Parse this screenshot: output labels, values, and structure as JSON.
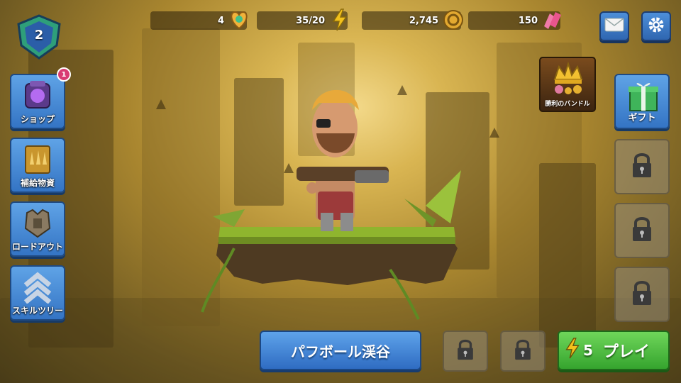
{
  "player": {
    "level": "2"
  },
  "resources": {
    "lives": "4",
    "energy": "35/20",
    "coins": "2,745",
    "gems": "150"
  },
  "top_buttons": {
    "mail_icon": "mail-icon",
    "settings_icon": "gear-icon"
  },
  "left_menu": [
    {
      "label": "ショップ",
      "icon": "shop-icon",
      "badge": "1"
    },
    {
      "label": "補給物資",
      "icon": "supply-crate-icon"
    },
    {
      "label": "ロードアウト",
      "icon": "armor-icon"
    },
    {
      "label": "スキルツリー",
      "icon": "chevron-rank-icon"
    }
  ],
  "bundle": {
    "label": "勝利のバンドル",
    "icon": "crown-icon"
  },
  "gift": {
    "label": "ギフト",
    "icon": "gift-icon"
  },
  "map": {
    "label": "パフボール渓谷"
  },
  "play": {
    "cost": "5",
    "label": "プレイ"
  },
  "colors": {
    "play": "#35a42e",
    "primary_button": "#3474c4",
    "badge": "#d83c72",
    "background": "#c9a444"
  }
}
